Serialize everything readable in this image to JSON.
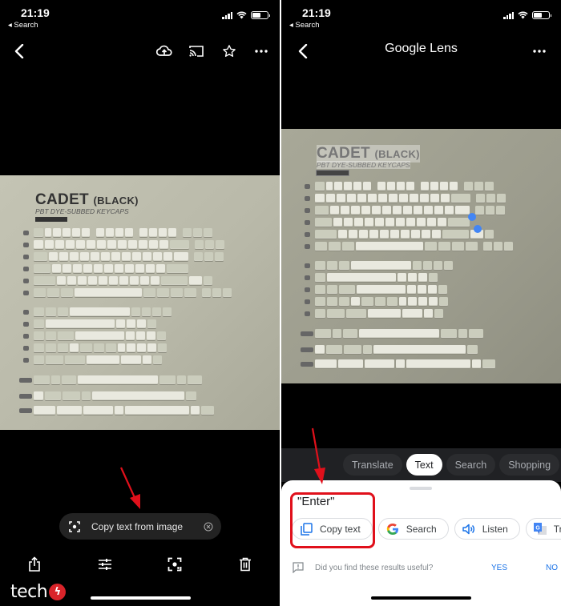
{
  "left": {
    "status": {
      "time": "21:19",
      "back_label": "◂ Search",
      "battery_level": 0.55
    },
    "navbar": {
      "icons": [
        "back-chevron-icon",
        "cloud-upload-icon",
        "cast-icon",
        "star-icon",
        "more-icon"
      ]
    },
    "photo": {
      "title": "CADET",
      "title_suffix": "(BLACK)",
      "subtitle": "PBT DYE-SUBBED KEYCAPS"
    },
    "copy_pill": {
      "label": "Copy text from image"
    },
    "toolbar": {
      "icons": [
        "share-icon",
        "adjust-icon",
        "lens-scan-icon",
        "trash-icon"
      ]
    },
    "watermark": {
      "text": "tech"
    }
  },
  "right": {
    "status": {
      "time": "21:19",
      "back_label": "◂ Search",
      "battery_level": 0.55
    },
    "navbar": {
      "title": "Google Lens"
    },
    "photo": {
      "title": "CADET",
      "title_suffix": "(BLACK)",
      "subtitle": "PBT DYE-SUBBED KEYCAPS"
    },
    "mode_tabs": [
      {
        "label": "Translate",
        "active": false
      },
      {
        "label": "Text",
        "active": true
      },
      {
        "label": "Search",
        "active": false
      },
      {
        "label": "Shopping",
        "active": false
      }
    ],
    "sheet": {
      "selected_text": "\"Enter\"",
      "chips": [
        {
          "label": "Copy text",
          "icon": "copy-icon"
        },
        {
          "label": "Search",
          "icon": "google-g-icon"
        },
        {
          "label": "Listen",
          "icon": "speaker-icon"
        },
        {
          "label": "Translate",
          "icon": "google-translate-icon"
        }
      ],
      "feedback": {
        "question": "Did you find these results useful?",
        "yes": "YES",
        "no": "NO"
      }
    }
  },
  "colors": {
    "annotation_red": "#e0101b",
    "google_blue": "#1a73e8",
    "selection_handle": "#4285f4",
    "pill_bg": "#232323"
  }
}
